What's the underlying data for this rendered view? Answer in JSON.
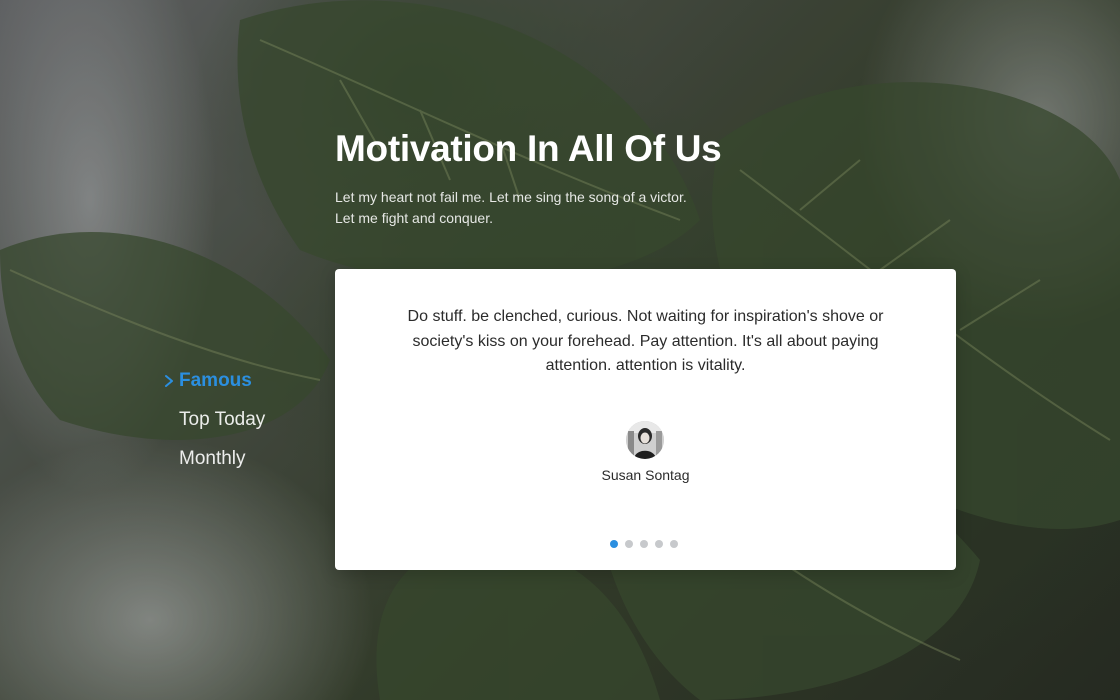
{
  "hero": {
    "title": "Motivation In All Of Us",
    "subtitle_lines": [
      "Let my heart not fail me. Let me sing the song of a victor.",
      "Let me fight and conquer."
    ]
  },
  "nav": {
    "items": [
      {
        "label": "Famous",
        "active": true
      },
      {
        "label": "Top Today",
        "active": false
      },
      {
        "label": "Monthly",
        "active": false
      }
    ]
  },
  "testimonial": {
    "quote": "Do stuff. be clenched, curious. Not waiting for inspiration's shove or society's kiss on your forehead. Pay attention. It's all about paying attention. attention is vitality.",
    "author": "Susan Sontag",
    "avatar_alt": "Susan Sontag portrait",
    "slides": 5,
    "active_slide": 1
  },
  "colors": {
    "accent": "#2b8fe0",
    "dot_inactive": "#c7c9cc",
    "card_bg": "#ffffff"
  }
}
